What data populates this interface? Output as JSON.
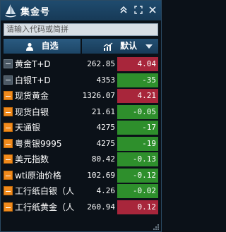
{
  "titlebar": {
    "title": "集金号",
    "buttons": [
      {
        "icon": "double-up-icon"
      },
      {
        "icon": "fullscreen-icon"
      },
      {
        "icon": "close-icon"
      }
    ]
  },
  "search": {
    "placeholder": "请输入代码或简拼"
  },
  "tabs": {
    "left": {
      "label": "自选",
      "icon": "user-icon"
    },
    "right": {
      "label": "默认",
      "icon": "chart-icon"
    }
  },
  "rows": [
    {
      "name": "黄金T+D",
      "price": "262.85",
      "change": "4.04",
      "trend": "up",
      "marker": "minus"
    },
    {
      "name": "白银T+D",
      "price": "4353",
      "change": "-35",
      "trend": "down",
      "marker": "minus"
    },
    {
      "name": "现货黄金",
      "price": "1326.07",
      "change": "4.21",
      "trend": "up",
      "marker": "orange"
    },
    {
      "name": "现货白银",
      "price": "21.61",
      "change": "-0.05",
      "trend": "down",
      "marker": "orange"
    },
    {
      "name": "天通银",
      "price": "4275",
      "change": "-17",
      "trend": "down",
      "marker": "orange"
    },
    {
      "name": "粤贵银9995",
      "price": "4275",
      "change": "-19",
      "trend": "down",
      "marker": "orange"
    },
    {
      "name": "美元指数",
      "price": "80.42",
      "change": "-0.13",
      "trend": "down",
      "marker": "orange"
    },
    {
      "name": "wti原油价格",
      "price": "102.69",
      "change": "-0.12",
      "trend": "down",
      "marker": "orange"
    },
    {
      "name": "工行纸白银（人",
      "price": "4.26",
      "change": "-0.02",
      "trend": "down",
      "marker": "orange"
    },
    {
      "name": "工行纸黄金（人",
      "price": "260.94",
      "change": "0.12",
      "trend": "up",
      "marker": "orange"
    }
  ],
  "colors": {
    "up": "#a8263b",
    "down": "#2e8f2c",
    "titlebar": "#1f4b6e",
    "background": "#0b1118"
  }
}
